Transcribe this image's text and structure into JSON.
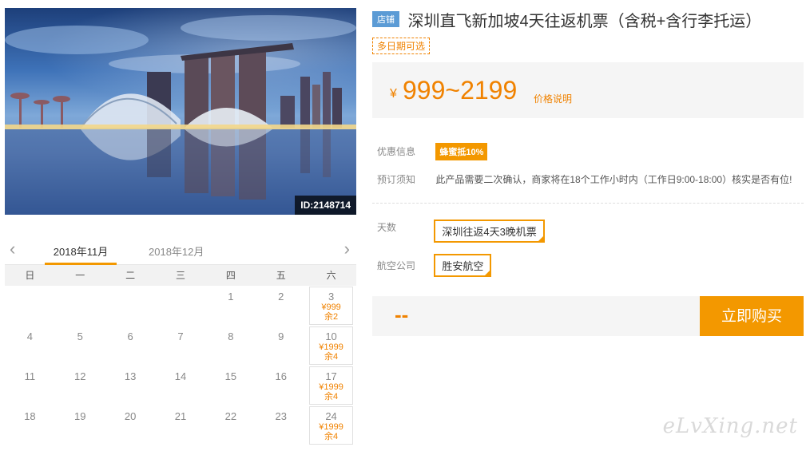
{
  "hero": {
    "image_id": "ID:2148714"
  },
  "calendar": {
    "prev_icon": "chevron-left-icon",
    "next_icon": "chevron-right-icon",
    "months": [
      "2018年11月",
      "2018年12月"
    ],
    "active_month": "2018年11月",
    "weekdays": [
      "日",
      "一",
      "二",
      "三",
      "四",
      "五",
      "六"
    ],
    "weeks": [
      [
        {
          "day": ""
        },
        {
          "day": ""
        },
        {
          "day": ""
        },
        {
          "day": ""
        },
        {
          "day": "1"
        },
        {
          "day": "2"
        },
        {
          "day": "3",
          "price": "¥999",
          "stock": "余2"
        }
      ],
      [
        {
          "day": "4"
        },
        {
          "day": "5"
        },
        {
          "day": "6"
        },
        {
          "day": "7"
        },
        {
          "day": "8"
        },
        {
          "day": "9"
        },
        {
          "day": "10",
          "price": "¥1999",
          "stock": "余4"
        }
      ],
      [
        {
          "day": "11"
        },
        {
          "day": "12"
        },
        {
          "day": "13"
        },
        {
          "day": "14"
        },
        {
          "day": "15"
        },
        {
          "day": "16"
        },
        {
          "day": "17",
          "price": "¥1999",
          "stock": "余4"
        }
      ],
      [
        {
          "day": "18"
        },
        {
          "day": "19"
        },
        {
          "day": "20"
        },
        {
          "day": "21"
        },
        {
          "day": "22"
        },
        {
          "day": "23"
        },
        {
          "day": "24",
          "price": "¥1999",
          "stock": "余4"
        }
      ]
    ]
  },
  "product": {
    "shop_badge": "店铺",
    "title": "深圳直飞新加坡4天往返机票（含税+含行李托运）",
    "multi_date_tag": "多日期可选",
    "price_currency": "¥",
    "price_range": "999~2199",
    "price_note": "价格说明",
    "promo_label": "优惠信息",
    "promo_badge": "蜂蜜抵10%",
    "notice_label": "预订须知",
    "notice_text": "此产品需要二次确认，商家将在18个工作小时内（工作日9:00-18:00）核实是否有位!",
    "days_label": "天数",
    "days_option": "深圳往返4天3晚机票",
    "airline_label": "航空公司",
    "airline_option": "胜安航空",
    "total": "--",
    "buy_button": "立即购买"
  },
  "watermark": "eLvXing.net",
  "colors": {
    "accent": "#f39800",
    "price": "#f08200",
    "badge_blue": "#5b9bd5"
  }
}
